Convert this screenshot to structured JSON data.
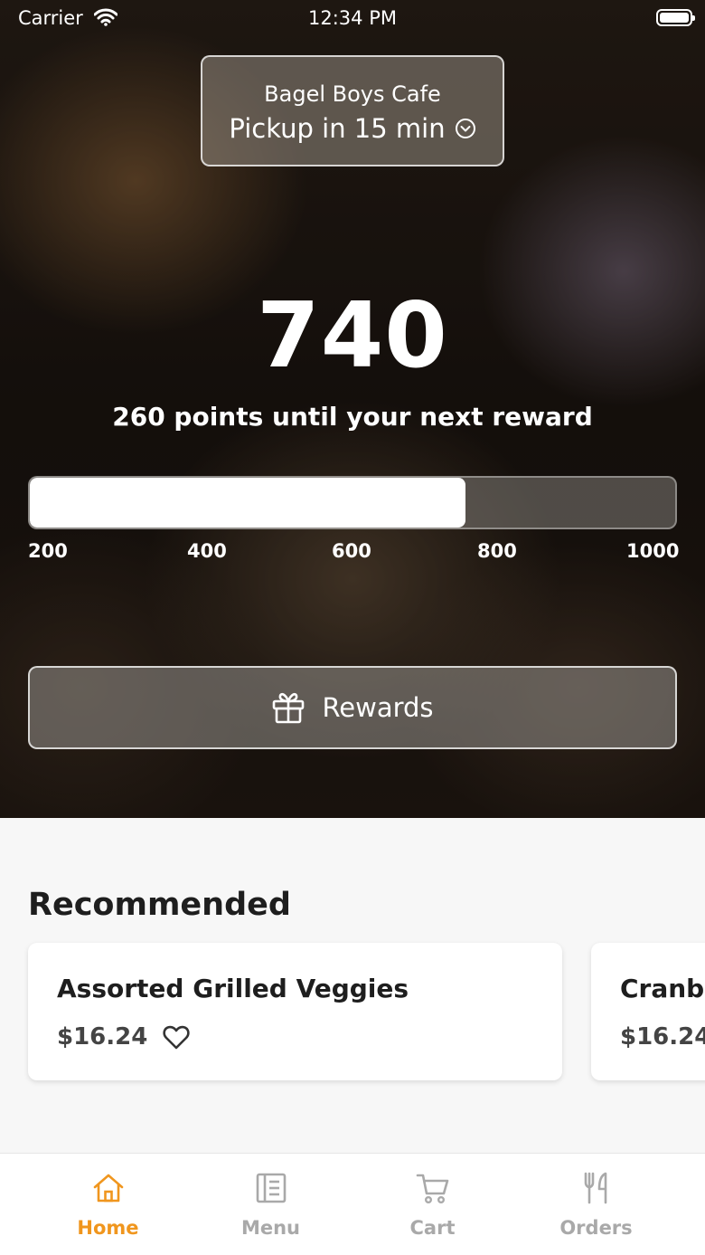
{
  "status_bar": {
    "carrier": "Carrier",
    "time": "12:34 PM"
  },
  "store": {
    "name": "Bagel Boys Cafe",
    "pickup": "Pickup in 15 min"
  },
  "rewards_progress": {
    "points": "740",
    "subtitle": "260 points until your next reward",
    "value": 740,
    "min": 200,
    "max": 1000,
    "ticks": [
      "200",
      "400",
      "600",
      "800",
      "1000"
    ]
  },
  "rewards_button": {
    "label": "Rewards"
  },
  "recommended": {
    "title": "Recommended",
    "items": [
      {
        "name": "Assorted Grilled Veggies",
        "price": "$16.24"
      },
      {
        "name": "Cranbe",
        "price": "$16.24"
      }
    ]
  },
  "tabs": [
    {
      "label": "Home",
      "icon": "home-icon",
      "active": true
    },
    {
      "label": "Menu",
      "icon": "menu-icon",
      "active": false
    },
    {
      "label": "Cart",
      "icon": "cart-icon",
      "active": false
    },
    {
      "label": "Orders",
      "icon": "utensils-icon",
      "active": false
    }
  ],
  "colors": {
    "accent": "#f0961e",
    "inactive": "#a9a9a9"
  }
}
